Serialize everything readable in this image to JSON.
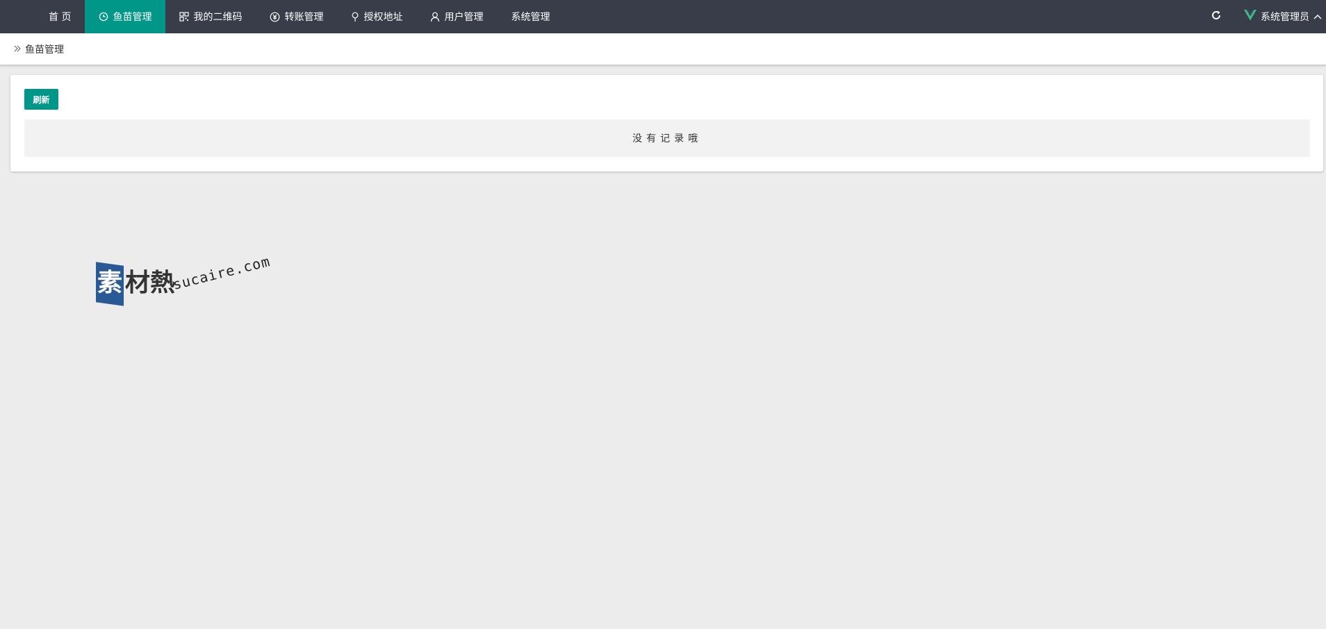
{
  "nav": {
    "items": [
      {
        "label": "首 页",
        "icon": "none"
      },
      {
        "label": "鱼苗管理",
        "icon": "fish-clock-icon",
        "active": true
      },
      {
        "label": "我的二维码",
        "icon": "qrcode-icon"
      },
      {
        "label": "转账管理",
        "icon": "yen-circle-icon"
      },
      {
        "label": "授权地址",
        "icon": "location-pin-icon"
      },
      {
        "label": "用户管理",
        "icon": "user-icon"
      },
      {
        "label": "系统管理",
        "icon": "none"
      }
    ],
    "right": {
      "refresh_icon": "refresh-icon",
      "user_label": "系统管理员",
      "logo_icon": "vue-logo-icon",
      "caret_icon": "chevron-up-icon"
    }
  },
  "breadcrumb": {
    "icon": "double-chevron-right-icon",
    "current": "鱼苗管理"
  },
  "card": {
    "refresh_button": "刷新",
    "empty_text": "没有记录哦"
  },
  "watermark": {
    "mark": "素",
    "chars": "材熱",
    "domain": "sucaire.com"
  },
  "colors": {
    "nav_bg": "#393d49",
    "accent": "#009688",
    "page_bg": "#ececec",
    "watermark_blue": "#2a5a96"
  }
}
